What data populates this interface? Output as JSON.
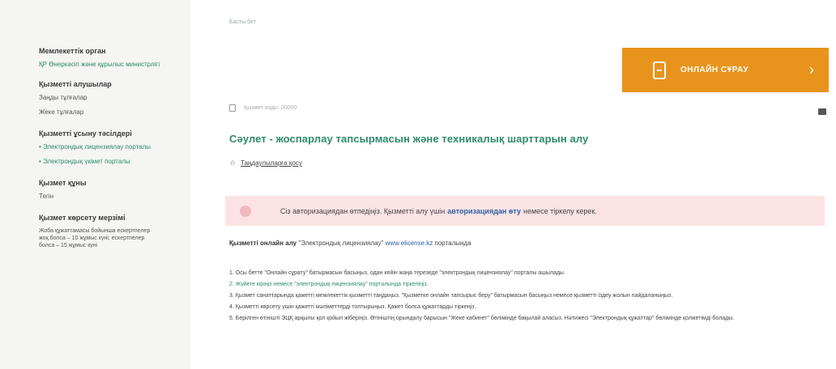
{
  "sidebar": {
    "section1_heading": "Мемлекеттік орган",
    "section1_link": "ҚР Өнеркәсіп және құрылыс министрлігі",
    "section2_heading": "Қызметті алушылар",
    "section2_items": [
      "Заңды тұлғалар",
      "Жеке тұлғалар"
    ],
    "section3_heading": "Қызметті ұсыну тәсілдері",
    "section3_items": [
      "• Электрондық лицензиялау порталы",
      "• Электрондық үкімет порталы"
    ],
    "section4_heading": "Қызмет құны",
    "section4_value": "Тегін",
    "section5_heading": "Қызмет көрсету мерзімі",
    "section5_text": "Жоба құжаттамасы бойынша ескертпелер жоқ болса – 10 жұмыс күні; ескертпелер болса – 15 жұмыс күні"
  },
  "main": {
    "breadcrumb": "Басты бет",
    "online_button_label": "ОНЛАЙН СҰРАУ",
    "service_code": "Қызмет коды: 00000",
    "title": "Сәулет - жоспарлау тапсырмасын және техникалық шарттарын алу",
    "favorites_label": "Таңдаулыларға қосу",
    "alert_text_before": "Сіз авторизациядан өтпедіңіз. Қызметті алу үшін",
    "alert_link": "авторизациядан өту",
    "alert_text_after": "немесе тіркелу керек.",
    "portal_label": "Қызметті онлайн алу",
    "portal_text": "\"Электрондық лицензиялау\"",
    "portal_link": "www.elicense.kz",
    "portal_suffix": "порталында",
    "steps": [
      "1. Осы бетте \"Онлайн сұрату\" батырмасын басыңыз, одан кейін жаңа терезеде \"электрондық лицензиялау\" порталы ашылады.",
      "2. Жүйеге кіріңіз немесе \"электрондық лицензиялау\" порталында тіркеліңіз.",
      "3. Қызмет санаттарында қажетті мемлекеттік қызметті таңдаңыз. \"Қызметке онлайн тапсырыс беру\" батырмасын басыңыз немесе қызметті іздеу жолын пайдаланыңыз.",
      "4. Қызметті көрсету үшін қажетті мәліметтерді толтырыңыз. Қажет болса құжаттарды тіркеңіз.",
      "5. Берілген өтінішті ЭЦҚ арқылы қол қойып жіберіңіз. Өтініштің орындалу барысын \"Жеке кабинет\" бөлімінде бақылай аласыз. Нәтижесі \"Электрондық құжаттар\" бөлімінде қолжетімді болады."
    ]
  },
  "colors": {
    "accent_green": "#2e8b6b",
    "button_orange": "#e8941c",
    "alert_bg": "#fbe3e4",
    "link_blue": "#2f5fa5"
  }
}
